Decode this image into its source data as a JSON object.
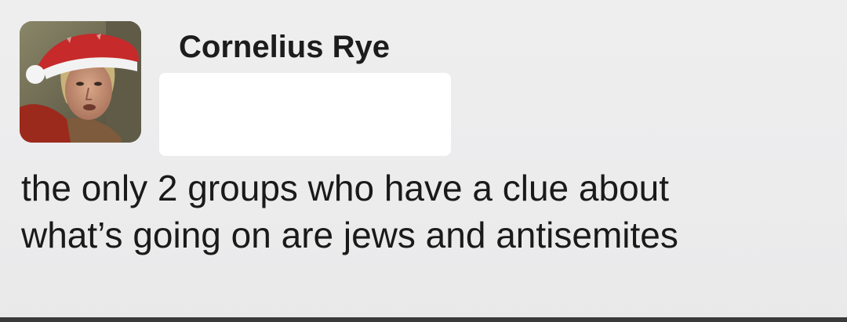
{
  "post": {
    "author_name": "Cornelius Rye",
    "text": "the only 2 groups who have a clue about\nwhat’s going on are jews and antisemites"
  },
  "avatar": {
    "icon": "profile-photo-santa-hat"
  },
  "colors": {
    "background": "#ededee",
    "redaction": "#ffffff",
    "text": "#1a1a1a"
  }
}
